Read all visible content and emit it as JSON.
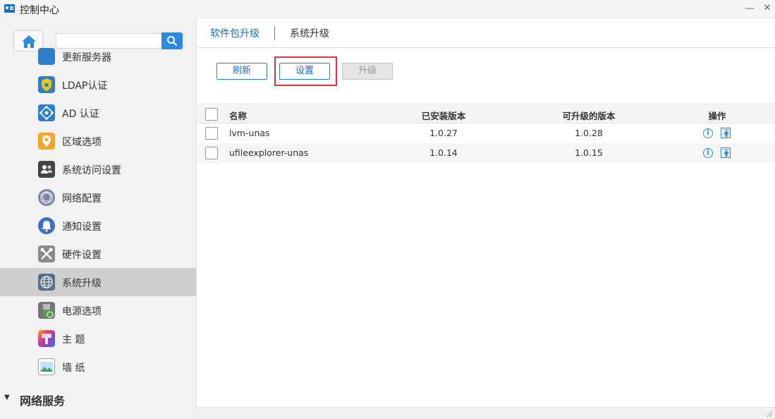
{
  "window": {
    "title": "控制中心",
    "minimize_glyph": "—",
    "close_glyph": "✕"
  },
  "sidebar": {
    "search": {
      "value": "",
      "placeholder": ""
    },
    "items": [
      {
        "label": "更新服务器",
        "icon": "update-server-icon",
        "color": "#2d7fc8"
      },
      {
        "label": "LDAP认证",
        "icon": "ldap-shield-icon",
        "color": "#2d7fc8"
      },
      {
        "label": "AD 认证",
        "icon": "ad-network-icon",
        "color": "#2d7fc8"
      },
      {
        "label": "区域选项",
        "icon": "location-pin-icon",
        "color": "#f5a623"
      },
      {
        "label": "系统访问设置",
        "icon": "users-access-icon",
        "color": "#444444"
      },
      {
        "label": "网络配置",
        "icon": "network-globe-icon",
        "color": "#7a86a8"
      },
      {
        "label": "通知设置",
        "icon": "bell-icon",
        "color": "#3a6fd0"
      },
      {
        "label": "硬件设置",
        "icon": "tools-icon",
        "color": "#8a8a8a"
      },
      {
        "label": "系统升级",
        "icon": "globe-upgrade-icon",
        "color": "#5a6f88"
      },
      {
        "label": "电源选项",
        "icon": "power-battery-icon",
        "color": "#55a040"
      },
      {
        "label": "主 题",
        "icon": "theme-palette-icon",
        "color": "#e0407a"
      },
      {
        "label": "墙 纸",
        "icon": "wallpaper-icon",
        "color": "#4a9e6e"
      }
    ],
    "active_index": 8,
    "section": {
      "arrow": "▼",
      "label": "网络服务"
    }
  },
  "tabs": [
    {
      "label": "软件包升级"
    },
    {
      "label": "系统升级"
    }
  ],
  "toolbar": {
    "refresh_label": "刷新",
    "settings_label": "设置",
    "upgrade_label": "升级"
  },
  "table": {
    "headers": {
      "name": "名称",
      "installed": "已安装版本",
      "available": "可升级的版本",
      "ops": "操作"
    },
    "rows": [
      {
        "name": "lvm-unas",
        "installed": "1.0.27",
        "available": "1.0.28"
      },
      {
        "name": "ufileexplorer-unas",
        "installed": "1.0.14",
        "available": "1.0.15"
      }
    ],
    "info_glyph": "i"
  },
  "colors": {
    "accent": "#2d8ae0",
    "highlight": "#e03030",
    "active_item": "#cfcfcf"
  }
}
